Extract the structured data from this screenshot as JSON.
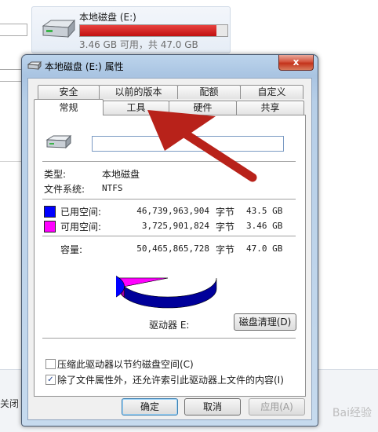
{
  "explorer": {
    "drive_title": "本地磁盘 (E:)",
    "drive_free_text": "3.46 GB 可用，共 47.0 GB",
    "drive_used_fraction": 0.926,
    "close_label": "关闭"
  },
  "dialog": {
    "title": "本地磁盘 (E:) 属性",
    "close_glyph": "x",
    "tabs_row1": [
      "安全",
      "以前的版本",
      "配额",
      "自定义"
    ],
    "tabs_row2": [
      "常规",
      "工具",
      "硬件",
      "共享"
    ],
    "active_tab": "常规",
    "name_value": "",
    "type_label": "类型:",
    "type_value": "本地磁盘",
    "fs_label": "文件系统:",
    "fs_value": "NTFS",
    "used": {
      "label": "已用空间:",
      "bytes": "46,739,963,904",
      "unit": "字节",
      "size": "43.5 GB",
      "color": "#0000ff"
    },
    "free": {
      "label": "可用空间:",
      "bytes": "3,725,901,824",
      "unit": "字节",
      "size": "3.46 GB",
      "color": "#ff00ff"
    },
    "capacity": {
      "label": "容量:",
      "bytes": "50,465,865,728",
      "unit": "字节",
      "size": "47.0 GB"
    },
    "drive_label": "驱动器 E:",
    "cleanup_button": "磁盘清理(D)",
    "compress_checkbox": {
      "label": "压缩此驱动器以节约磁盘空间(C)",
      "checked": false
    },
    "index_checkbox": {
      "label": "除了文件属性外，还允许索引此驱动器上文件的内容(I)",
      "checked": true
    },
    "ok_button": "确定",
    "cancel_button": "取消",
    "apply_button": "应用(A)"
  },
  "pie": {
    "used_fraction": 0.926
  },
  "watermark": "Bai经验"
}
